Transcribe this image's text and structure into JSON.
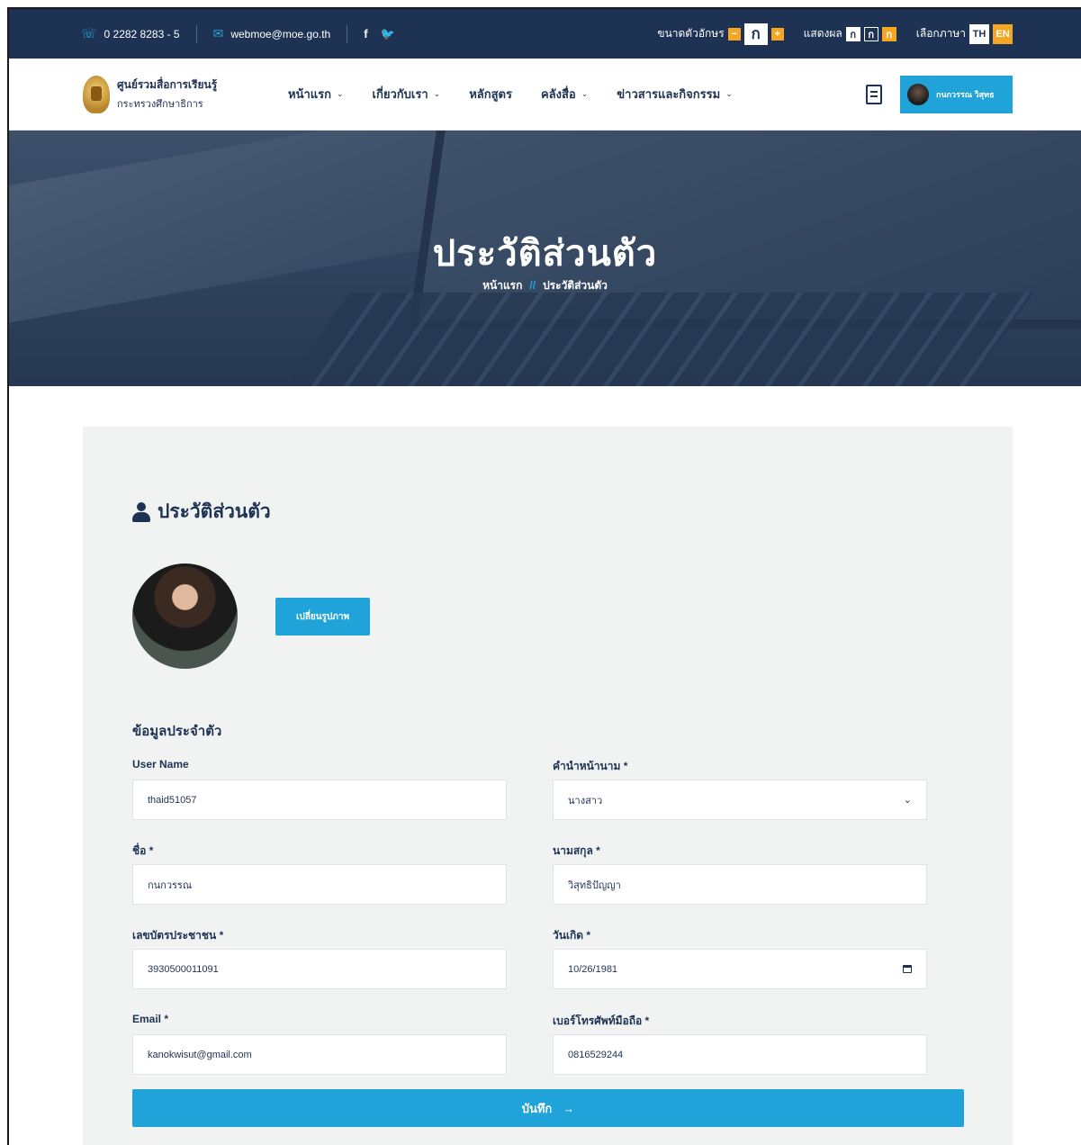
{
  "topbar": {
    "phone": "0 2282 8283 - 5",
    "email": "webmoe@moe.go.th",
    "social": [
      "f",
      "🐦"
    ],
    "font_size_label": "ขนาดตัวอักษร",
    "font_minus": "−",
    "font_char": "ก",
    "font_plus": "+",
    "display_label": "แสดงผล",
    "display_options": [
      "ก",
      "ก",
      "ก"
    ],
    "language_label": "เลือกภาษา",
    "lang_th": "TH",
    "lang_en": "EN"
  },
  "nav": {
    "logo_line1": "ศูนย์รวมสื่อการเรียนรู้",
    "logo_line2": "กระทรวงศึกษาธิการ",
    "menu": [
      {
        "label": "หน้าแรก",
        "dropdown": true
      },
      {
        "label": "เกี่ยวกับเรา",
        "dropdown": true
      },
      {
        "label": "หลักสูตร",
        "dropdown": false
      },
      {
        "label": "คลังสื่อ",
        "dropdown": true
      },
      {
        "label": "ข่าวสารและกิจกรรม",
        "dropdown": true
      }
    ],
    "user_name": "กนกวรรณ วิสุทธ"
  },
  "hero": {
    "title": "ประวัติส่วนตัว",
    "breadcrumb_home": "หน้าแรก",
    "breadcrumb_sep": "//",
    "breadcrumb_current": "ประวัติส่วนตัว"
  },
  "profile": {
    "heading": "ประวัติส่วนตัว",
    "change_photo": "เปลี่ยนรูปภาพ",
    "section_title": "ข้อมูลประจำตัว",
    "fields": {
      "username": {
        "label": "User Name",
        "value": "thaid51057"
      },
      "prefix": {
        "label": "คำนำหน้านาม *",
        "value": "นางสาว"
      },
      "firstname": {
        "label": "ชื่อ *",
        "value": "กนกวรรณ"
      },
      "lastname": {
        "label": "นามสกุล *",
        "value": "วิสุทธิปัญญา"
      },
      "idcard": {
        "label": "เลขบัตรประชาชน *",
        "value": "3930500011091"
      },
      "birthdate": {
        "label": "วันเกิด *",
        "value": "10/26/1981"
      },
      "email": {
        "label": "Email *",
        "value": "kanokwisut@gmail.com"
      },
      "mobile": {
        "label": "เบอร์โทรศัพท์มือถือ *",
        "value": "0816529244"
      }
    },
    "save": "บันทึก",
    "save_arrow": "→"
  },
  "colors": {
    "topbar_bg": "#1e3354",
    "accent": "#1fa3d8",
    "orange": "#f5a623",
    "card_bg": "#f1f3f3"
  }
}
